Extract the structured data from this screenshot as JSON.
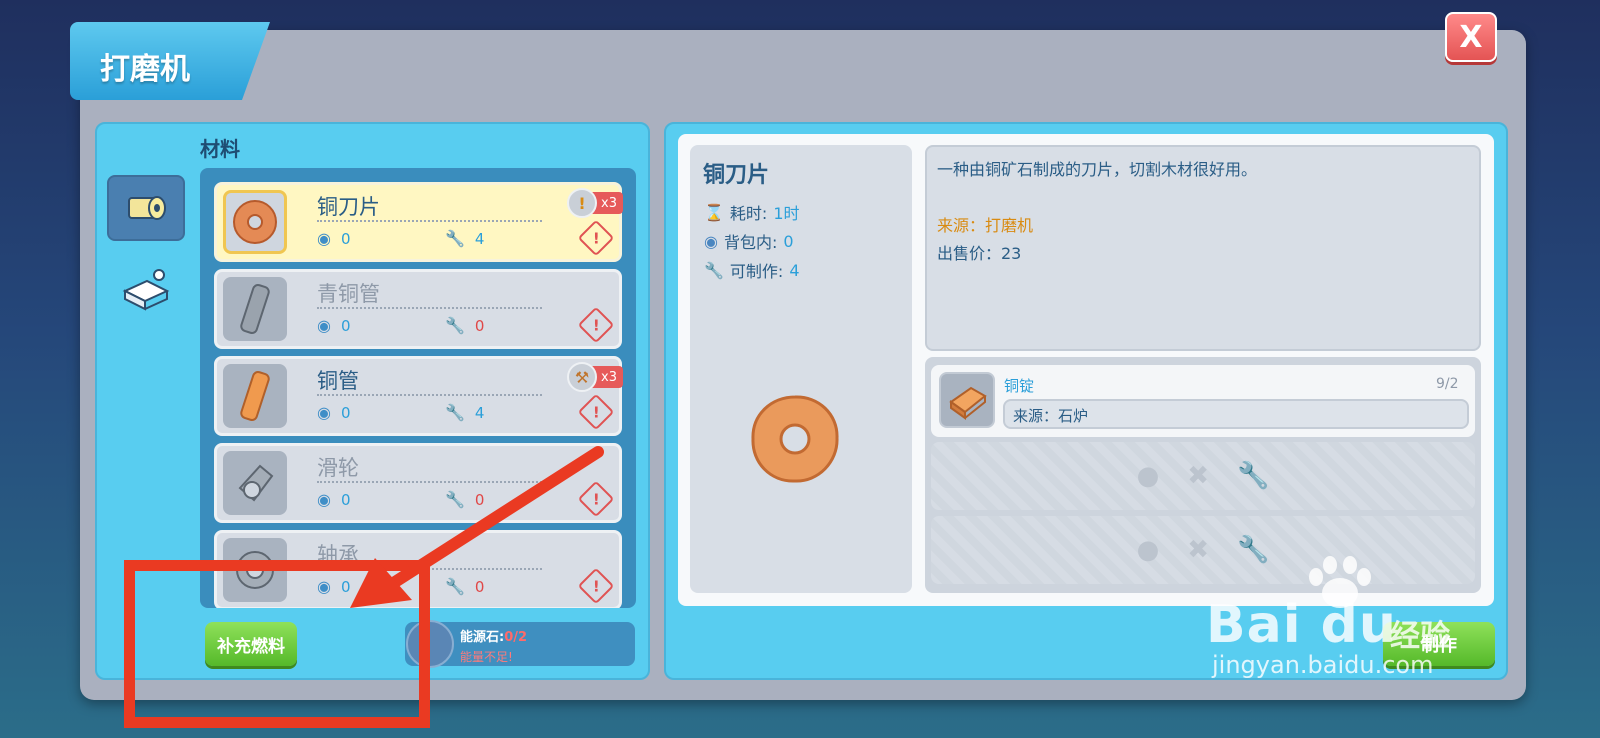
{
  "window": {
    "title": "打磨机",
    "close_label": "X"
  },
  "left": {
    "section_label": "材料",
    "items": [
      {
        "name": "铜刀片",
        "bag": "0",
        "craftable": "4",
        "badge": "x3",
        "state": "selected"
      },
      {
        "name": "青铜管",
        "bag": "0",
        "craftable": "0",
        "badge": "",
        "state": "dim"
      },
      {
        "name": "铜管",
        "bag": "0",
        "craftable": "4",
        "badge": "x3",
        "state": "normal"
      },
      {
        "name": "滑轮",
        "bag": "0",
        "craftable": "0",
        "badge": "",
        "state": "dim"
      },
      {
        "name": "轴承",
        "bag": "0",
        "craftable": "0",
        "badge": "",
        "state": "dim"
      }
    ],
    "refuel_label": "补充燃料",
    "energy_label": "能源石:",
    "energy_value": "0/2",
    "energy_warning": "能量不足!"
  },
  "detail": {
    "name": "铜刀片",
    "time_label": "耗时:",
    "time_value": "1时",
    "bag_label": "背包内:",
    "bag_value": "0",
    "craft_label": "可制作:",
    "craft_value": "4",
    "description": "一种由铜矿石制成的刀片，切割木材很好用。",
    "source": "来源：打磨机",
    "price": "出售价：23"
  },
  "requirement": {
    "name": "铜锭",
    "count": "9/2",
    "source": "来源：石炉"
  },
  "make_label": "制作",
  "watermark": {
    "logo": "Bai du",
    "cn": "经验",
    "url": "jingyan.baidu.com"
  },
  "colors": {
    "accent": "#58cdf0",
    "annotation": "#ea3a22",
    "green": "#55b92a"
  }
}
